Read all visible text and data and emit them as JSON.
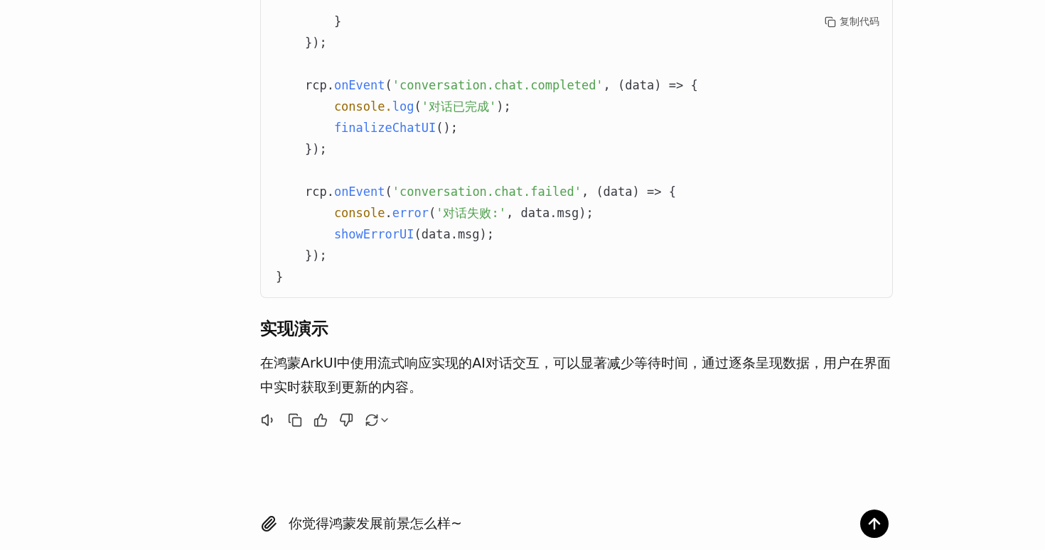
{
  "code_block": {
    "copy_button": "复制代码",
    "lines": [
      {
        "kind": "code",
        "tokens": [
          {
            "text": "        }",
            "kind": "plain"
          }
        ]
      },
      {
        "kind": "code",
        "tokens": [
          {
            "text": "    });",
            "kind": "plain"
          }
        ]
      },
      {
        "kind": "blank"
      },
      {
        "kind": "code",
        "tokens": [
          {
            "text": "    rcp.",
            "kind": "plain"
          },
          {
            "text": "onEvent",
            "kind": "fn"
          },
          {
            "text": "(",
            "kind": "plain"
          },
          {
            "text": "'conversation.chat.completed'",
            "kind": "str"
          },
          {
            "text": ", (data) => {",
            "kind": "plain"
          }
        ]
      },
      {
        "kind": "code",
        "tokens": [
          {
            "text": "        console.",
            "kind": "obj"
          },
          {
            "text": "log",
            "kind": "fn"
          },
          {
            "text": "(",
            "kind": "plain"
          },
          {
            "text": "'对话已完成'",
            "kind": "str"
          },
          {
            "text": ");",
            "kind": "plain"
          }
        ]
      },
      {
        "kind": "code",
        "tokens": [
          {
            "text": "        finalizeChatUI",
            "kind": "fn"
          },
          {
            "text": "();",
            "kind": "plain"
          }
        ]
      },
      {
        "kind": "code",
        "tokens": [
          {
            "text": "    });",
            "kind": "plain"
          }
        ]
      },
      {
        "kind": "blank"
      },
      {
        "kind": "code",
        "tokens": [
          {
            "text": "    rcp.",
            "kind": "plain"
          },
          {
            "text": "onEvent",
            "kind": "fn"
          },
          {
            "text": "(",
            "kind": "plain"
          },
          {
            "text": "'conversation.chat.failed'",
            "kind": "str"
          },
          {
            "text": ", (data) => {",
            "kind": "plain"
          }
        ]
      },
      {
        "kind": "code",
        "tokens": [
          {
            "text": "        console",
            "kind": "obj"
          },
          {
            "text": ".",
            "kind": "plain"
          },
          {
            "text": "error",
            "kind": "fn"
          },
          {
            "text": "(",
            "kind": "plain"
          },
          {
            "text": "'对话失败:'",
            "kind": "str"
          },
          {
            "text": ", data.msg);",
            "kind": "plain"
          }
        ]
      },
      {
        "kind": "code",
        "tokens": [
          {
            "text": "        showErrorUI",
            "kind": "fn"
          },
          {
            "text": "(data.msg);",
            "kind": "plain"
          }
        ]
      },
      {
        "kind": "code",
        "tokens": [
          {
            "text": "    });",
            "kind": "plain"
          }
        ]
      },
      {
        "kind": "code",
        "tokens": [
          {
            "text": "}",
            "kind": "plain"
          }
        ]
      }
    ]
  },
  "heading": "实现演示",
  "paragraph": "在鸿蒙ArkUI中使用流式响应实现的AI对话交互，可以显著减少等待时间，通过逐条呈现数据，用户在界面中实时获取到更新的内容。",
  "actions": [
    {
      "kind": "speak"
    },
    {
      "kind": "copy"
    },
    {
      "kind": "like"
    },
    {
      "kind": "dislike"
    },
    {
      "kind": "regenerate"
    }
  ],
  "composer": {
    "value": "你觉得鸿蒙发展前景怎么样~"
  }
}
